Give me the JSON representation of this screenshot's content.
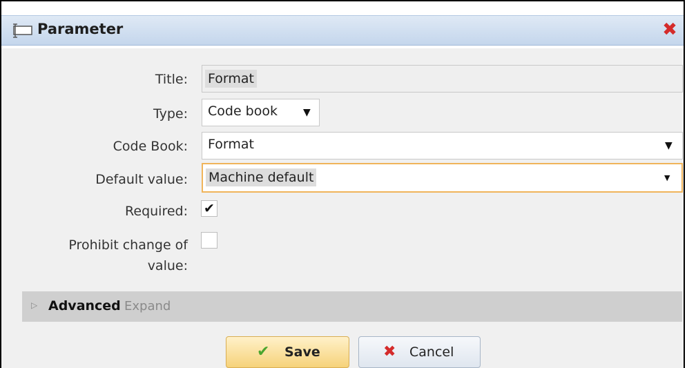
{
  "dialog": {
    "title": "Parameter",
    "close_icon": "close-icon"
  },
  "form": {
    "title_label": "Title:",
    "title_value": "Format",
    "type_label": "Type:",
    "type_value": "Code book",
    "codebook_label": "Code Book:",
    "codebook_value": "Format",
    "default_label": "Default value:",
    "default_value": "Machine default",
    "required_label": "Required:",
    "required_checked": true,
    "prohibit_label_line1": "Prohibit change of",
    "prohibit_label_line2": "value:",
    "prohibit_checked": false
  },
  "advanced": {
    "title": "Advanced",
    "expand": "Expand"
  },
  "buttons": {
    "save": "Save",
    "cancel": "Cancel"
  },
  "colors": {
    "focus_border": "#f0b45a",
    "close_red": "#d42b2b",
    "save_check_green": "#4aa52e"
  }
}
